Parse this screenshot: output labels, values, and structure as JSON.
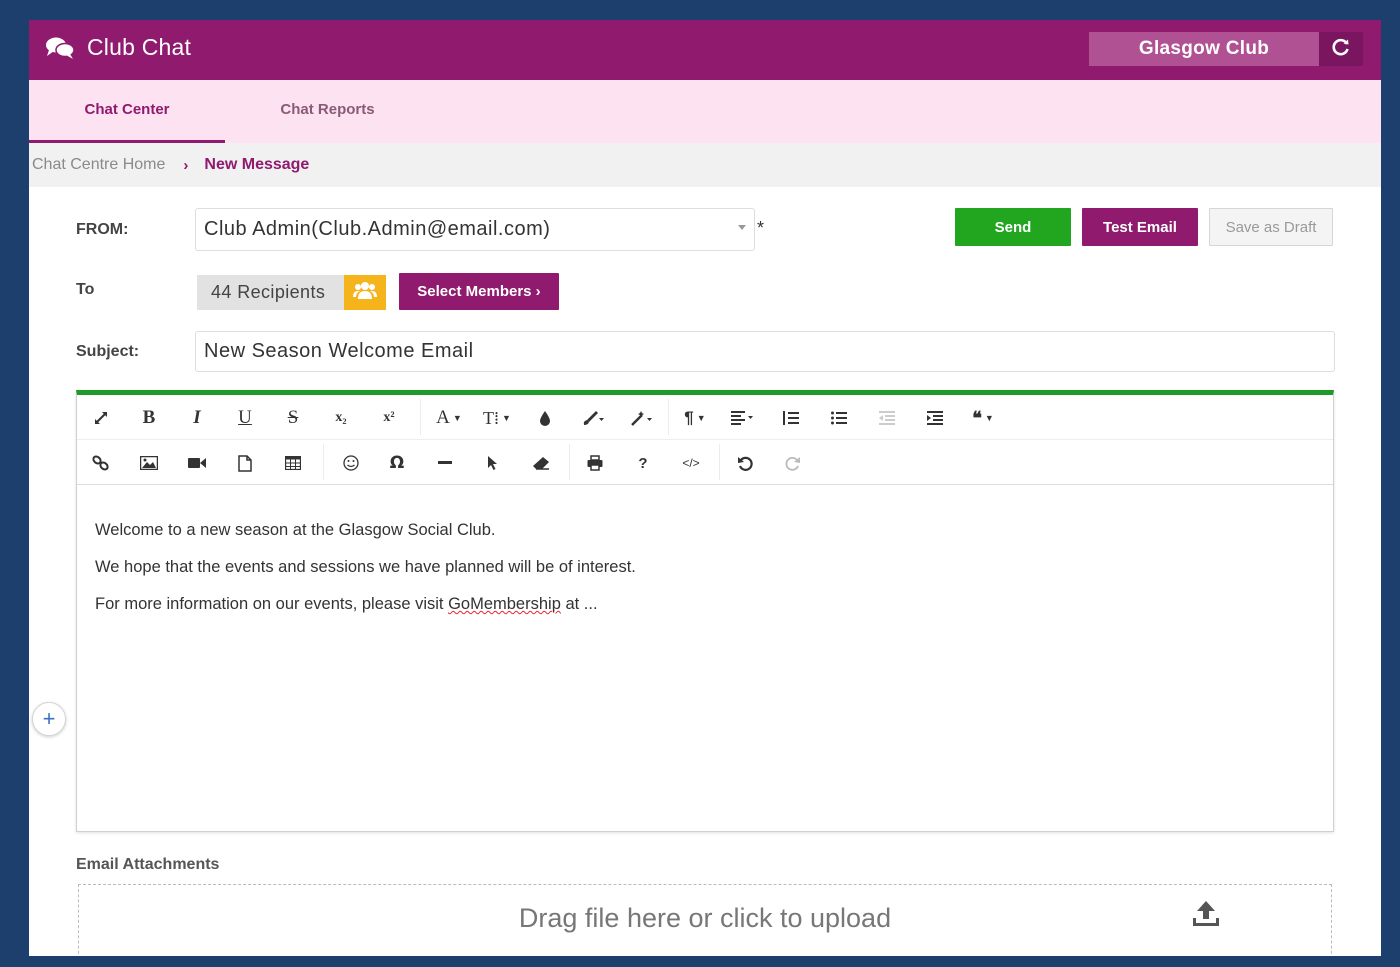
{
  "header": {
    "title": "Club Chat",
    "club_name": "Glasgow Club",
    "icons": {
      "chat": "chat-bubbles-icon",
      "refresh": "refresh-icon"
    }
  },
  "tabs": [
    {
      "label": "Chat Center",
      "active": true
    },
    {
      "label": "Chat Reports",
      "active": false
    }
  ],
  "breadcrumb": {
    "home": "Chat Centre Home",
    "separator": "›",
    "current": "New Message"
  },
  "form": {
    "from_label": "FROM:",
    "from_value": "Club Admin(Club.Admin@email.com)",
    "required_mark": "*",
    "to_label": "To",
    "recipients": "44 Recipients",
    "select_members_label": "Select Members ›",
    "subject_label": "Subject:",
    "subject_value": "New Season Welcome Email"
  },
  "actions": {
    "send": "Send",
    "test_email": "Test Email",
    "save_draft": "Save as Draft"
  },
  "toolbar": {
    "row1": [
      "expand-icon",
      "bold-icon",
      "italic-icon",
      "underline-icon",
      "strikethrough-icon",
      "subscript-icon",
      "superscript-icon",
      "font-color-icon",
      "font-size-icon",
      "color-drop-icon",
      "paint-brush-icon",
      "magic-wand-icon",
      "paragraph-icon",
      "align-icon",
      "ordered-list-icon",
      "unordered-list-icon",
      "outdent-icon",
      "indent-icon",
      "quote-icon"
    ],
    "row2": [
      "link-icon",
      "image-icon",
      "video-icon",
      "file-icon",
      "table-icon",
      "emoji-icon",
      "special-char-icon",
      "horizontal-rule-icon",
      "select-all-icon",
      "eraser-icon",
      "print-icon",
      "help-icon",
      "code-view-icon",
      "undo-icon",
      "redo-icon"
    ],
    "glyphs": {
      "bold": "B",
      "italic": "I",
      "underline": "U",
      "strike": "S",
      "subscript": "x₂",
      "superscript": "x²",
      "font_color": "A",
      "font_size": "T⁞",
      "paragraph": "¶",
      "omega": "Ω",
      "help": "?",
      "code": "</>",
      "quote": "❝"
    }
  },
  "editor": {
    "lines": [
      "Welcome to a new season at the Glasgow Social Club.",
      "We hope that the events and sessions we have planned will be of interest.",
      "For more information on our events, please visit "
    ],
    "link_word": "GoMembership",
    "line3_suffix": " at ..."
  },
  "attachments": {
    "label": "Email Attachments",
    "dropzone_text": "Drag file here or click to upload"
  },
  "colors": {
    "brand": "#8f1a6e",
    "tab_bg": "#fde2f1",
    "send": "#22a51f",
    "recipients_icon": "#f5b31c",
    "frame": "#1c3f6e"
  }
}
